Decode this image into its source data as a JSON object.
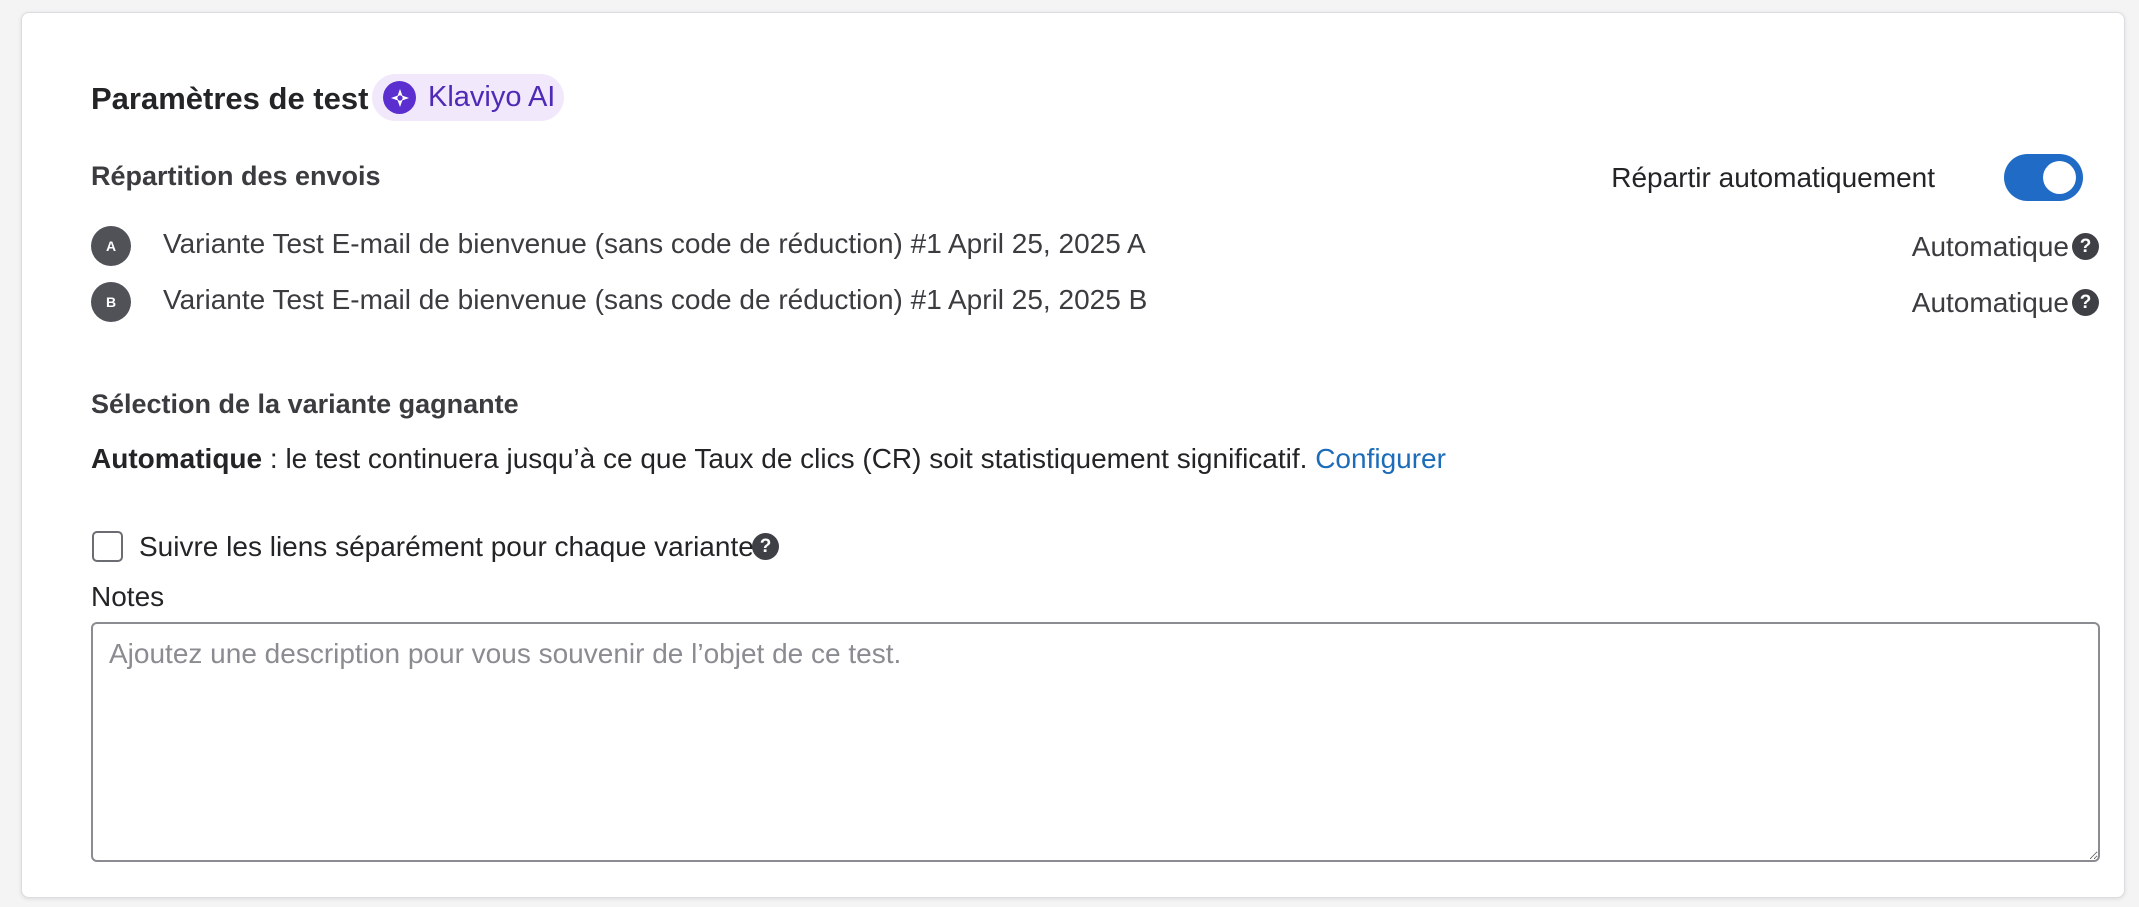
{
  "header": {
    "title": "Paramètres de test",
    "ai_badge": {
      "label": "Klaviyo AI",
      "icon": "sparkle-icon"
    }
  },
  "distribution": {
    "title": "Répartition des envois",
    "auto_toggle_label": "Répartir automatiquement",
    "auto_toggle_on": true,
    "variants": [
      {
        "letter": "A",
        "name": "Variante Test E-mail de bienvenue (sans code de réduction) #1 April 25, 2025 A",
        "split": "Automatique"
      },
      {
        "letter": "B",
        "name": "Variante Test E-mail de bienvenue (sans code de réduction) #1 April 25, 2025 B",
        "split": "Automatique"
      }
    ]
  },
  "winner": {
    "title": "Sélection de la variante gagnante",
    "mode": "Automatique",
    "description": " : le test continuera jusqu’à ce que Taux de clics (CR) soit statistiquement significatif. ",
    "configure_link": "Configurer"
  },
  "tracking": {
    "label": "Suivre les liens séparément pour chaque variante",
    "checked": false
  },
  "notes": {
    "label": "Notes",
    "placeholder": "Ajoutez une description pour vous souvenir de l’objet de ce test.",
    "value": ""
  },
  "help_glyph": "?",
  "colors": {
    "accent": "#1f6bc6",
    "link": "#1c6cba",
    "ai_badge_bg": "#f1e8fb",
    "ai_icon": "#5a2ecf"
  }
}
